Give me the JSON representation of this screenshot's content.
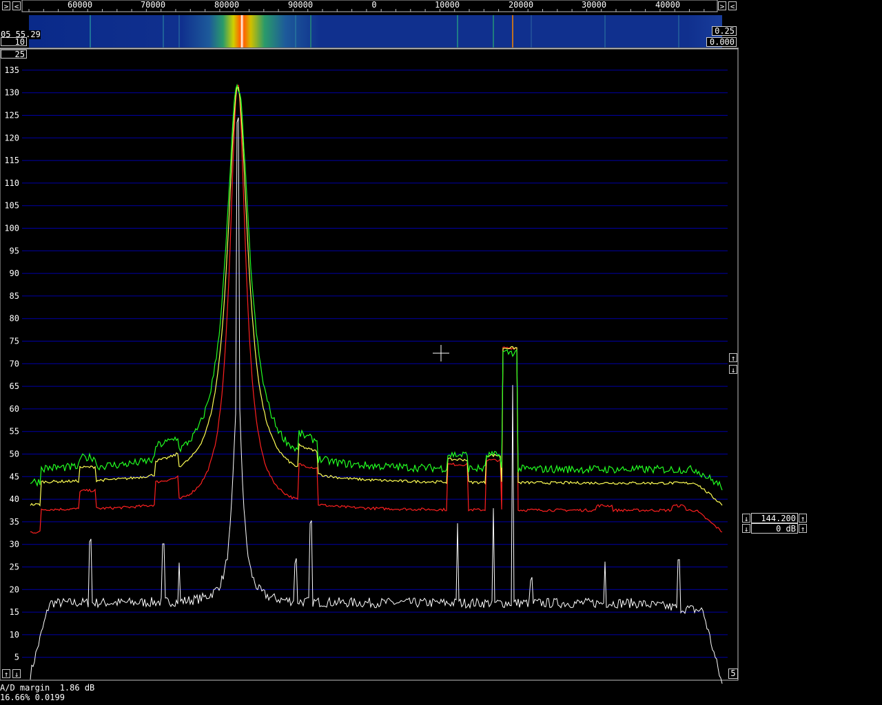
{
  "freq_axis": {
    "labels": [
      "60000",
      "70000",
      "80000",
      "90000",
      "0",
      "10000",
      "20000",
      "30000",
      "40000"
    ]
  },
  "waterfall": {
    "time": "05 55.29",
    "left_value": "10",
    "right_top": "0.25",
    "right_bottom": "0.000"
  },
  "spectrum": {
    "top_box": "25",
    "y_labels": [
      "135",
      "130",
      "125",
      "120",
      "115",
      "110",
      "105",
      "100",
      "95",
      "90",
      "85",
      "80",
      "75",
      "70",
      "65",
      "60",
      "55",
      "50",
      "45",
      "40",
      "35",
      "30",
      "25",
      "20",
      "15",
      "10",
      "5"
    ],
    "bottom_right_box": "5"
  },
  "controls": {
    "freq_value": "144.200",
    "gain_value": "0 dB"
  },
  "status": {
    "line1": "A/D margin  1.86 dB",
    "line2": "16.66% 0.0199"
  },
  "colors": {
    "grid": "#0000a8",
    "green_trace": "#22ff22",
    "yellow_trace": "#ffff55",
    "red_trace": "#ff2020",
    "white_trace": "#ffffff"
  }
}
